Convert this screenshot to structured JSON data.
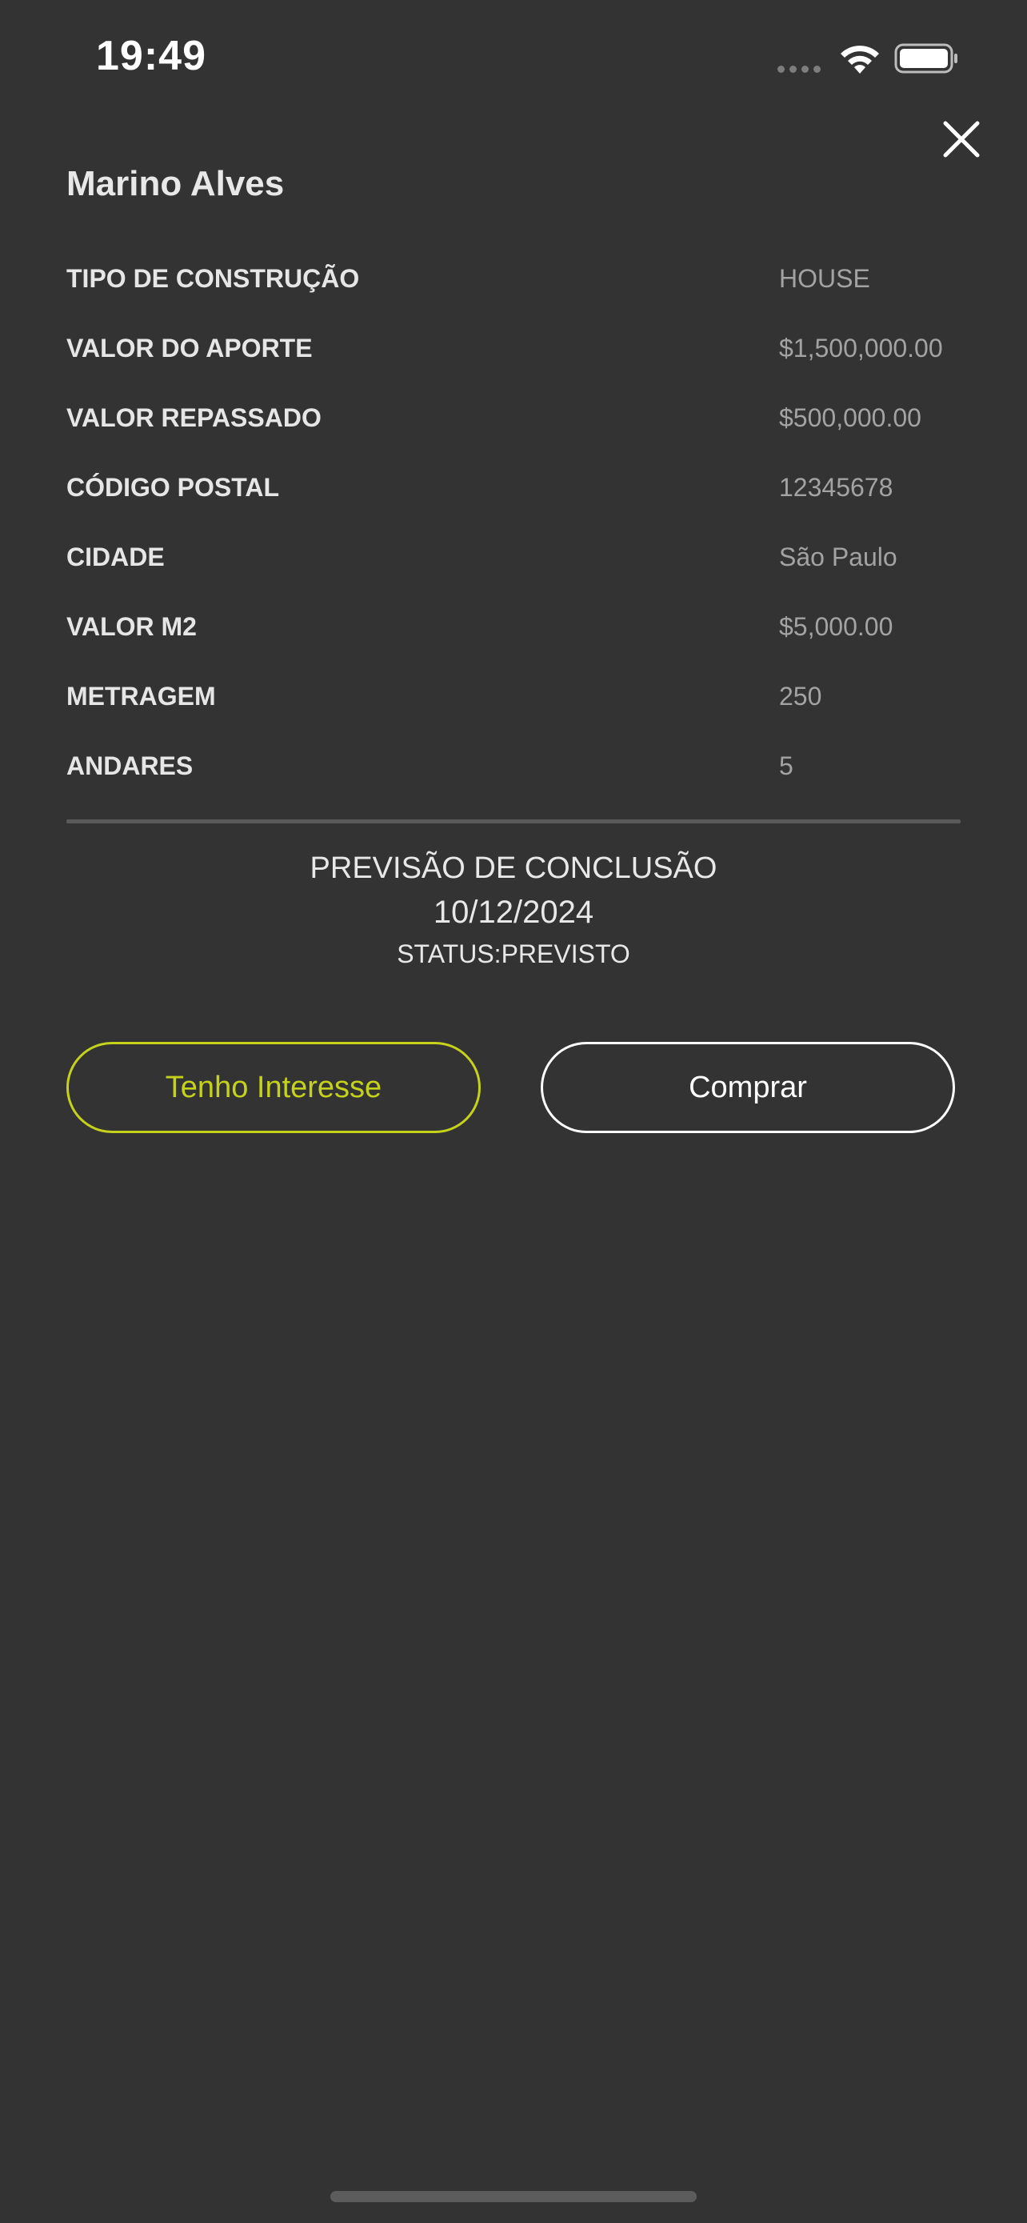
{
  "status_bar": {
    "time": "19:49",
    "signal_icon": "signal-dots-icon",
    "wifi_icon": "wifi-icon",
    "battery_icon": "battery-icon"
  },
  "header": {
    "title": "Marino Alves",
    "close_icon": "close-icon"
  },
  "details": [
    {
      "label": "TIPO DE CONSTRUÇÃO",
      "value": "HOUSE"
    },
    {
      "label": "VALOR DO APORTE",
      "value": "$1,500,000.00"
    },
    {
      "label": "VALOR REPASSADO",
      "value": "$500,000.00"
    },
    {
      "label": "CÓDIGO POSTAL",
      "value": "12345678"
    },
    {
      "label": "CIDADE",
      "value": "São Paulo"
    },
    {
      "label": "VALOR M2",
      "value": "$5,000.00"
    },
    {
      "label": "METRAGEM",
      "value": "250"
    },
    {
      "label": "ANDARES",
      "value": "5"
    }
  ],
  "forecast": {
    "label": "PREVISÃO DE CONCLUSÃO",
    "date": "10/12/2024",
    "status": "STATUS:PREVISTO"
  },
  "actions": {
    "interest_label": "Tenho Interesse",
    "buy_label": "Comprar"
  },
  "colors": {
    "background": "#333333",
    "accent": "#c5d21c",
    "label_text": "#e6e6e6",
    "value_text": "#a3a3a3"
  }
}
